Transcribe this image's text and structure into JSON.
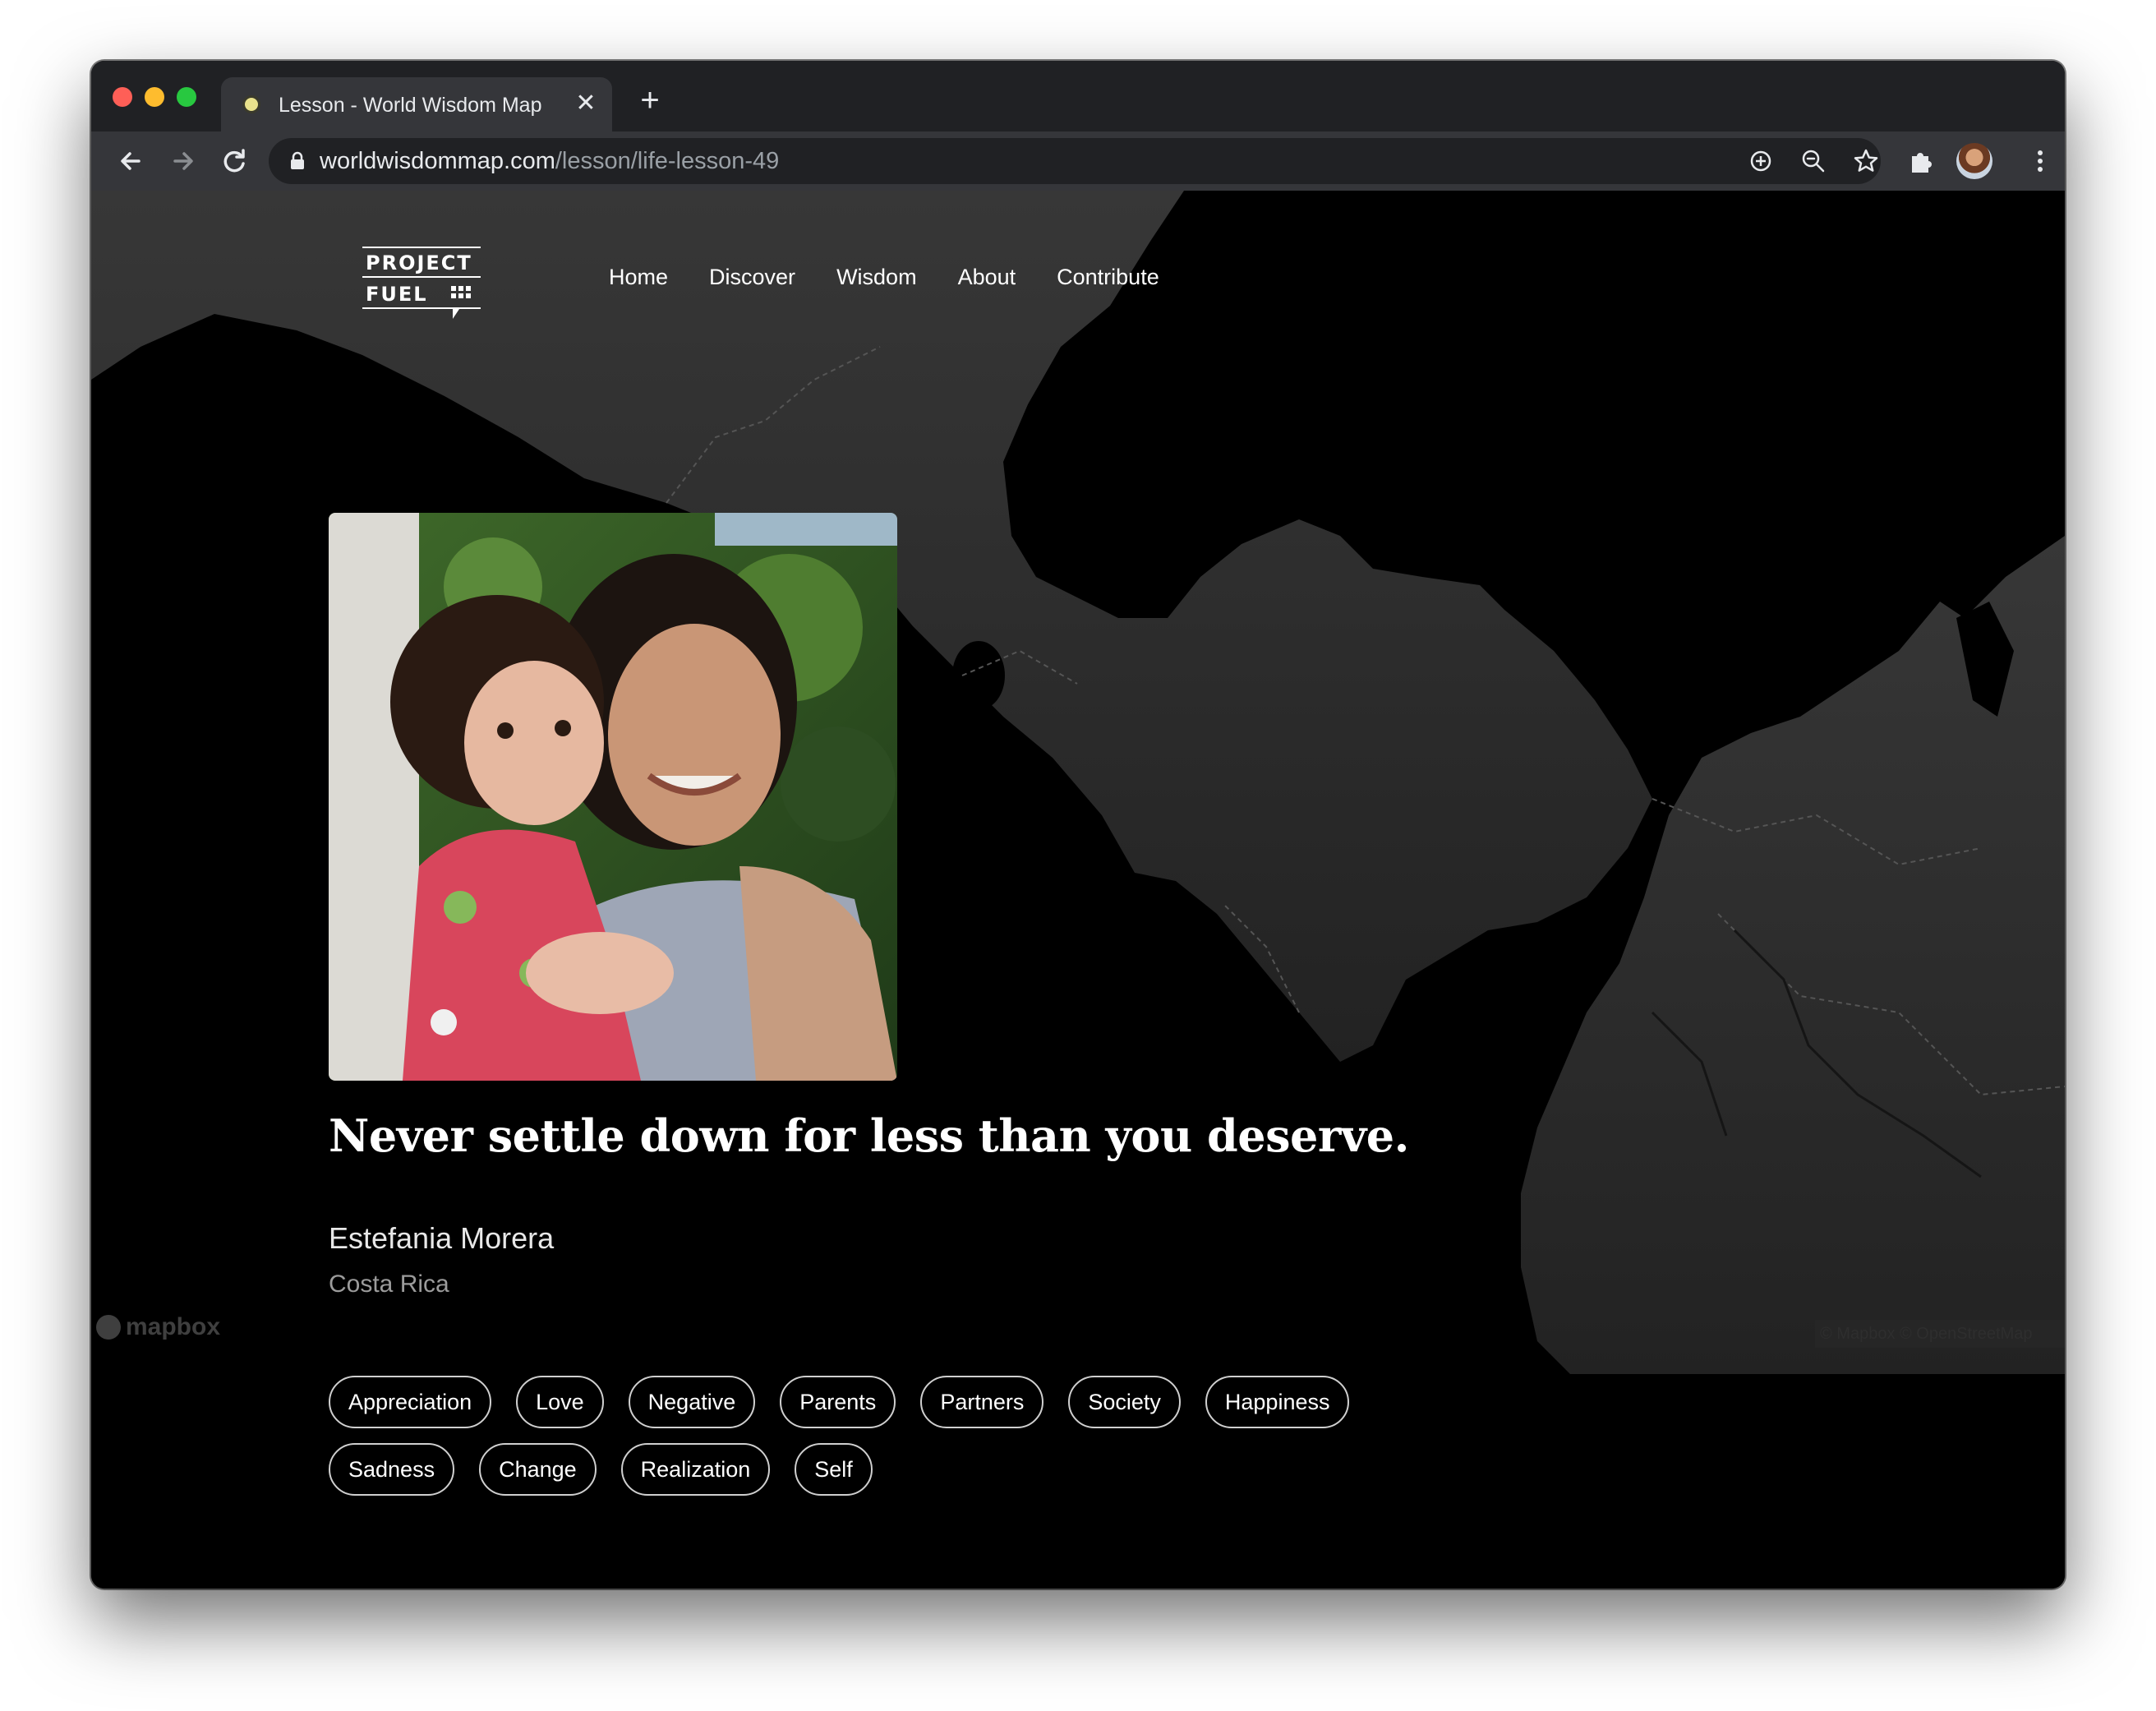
{
  "browser": {
    "tab_title": "Lesson - World Wisdom Map",
    "tab_close": "✕",
    "new_tab": "+",
    "url_host": "worldwisdommap.com",
    "url_path": "/lesson/life-lesson-49"
  },
  "site": {
    "logo_line1": "PROJECT",
    "logo_line2": "FUEL",
    "nav": [
      "Home",
      "Discover",
      "Wisdom",
      "About",
      "Contribute"
    ]
  },
  "lesson": {
    "quote": "Never settle down for less than you deserve.",
    "author": "Estefania Morera",
    "country": "Costa Rica",
    "tags_row1": [
      "Appreciation",
      "Love",
      "Negative",
      "Parents",
      "Partners",
      "Society",
      "Happiness"
    ],
    "tags_row2": [
      "Sadness",
      "Change",
      "Realization",
      "Self"
    ]
  },
  "map": {
    "provider_logo": "mapbox",
    "attribution": "© Mapbox © OpenStreetMap"
  },
  "icons": {
    "back": "arrow-left-icon",
    "forward": "arrow-right-icon",
    "reload": "reload-icon",
    "lock": "lock-icon",
    "install": "install-icon",
    "zoom": "zoom-out-icon",
    "bookmark": "star-icon",
    "extensions": "puzzle-icon",
    "menu": "kebab-menu-icon"
  },
  "colors": {
    "chrome_dark": "#202124",
    "toolbar": "#35363a",
    "page_bg": "#000000",
    "land": "#2b2b2b",
    "text_primary": "#ffffff",
    "text_muted": "#9b9b9b"
  }
}
